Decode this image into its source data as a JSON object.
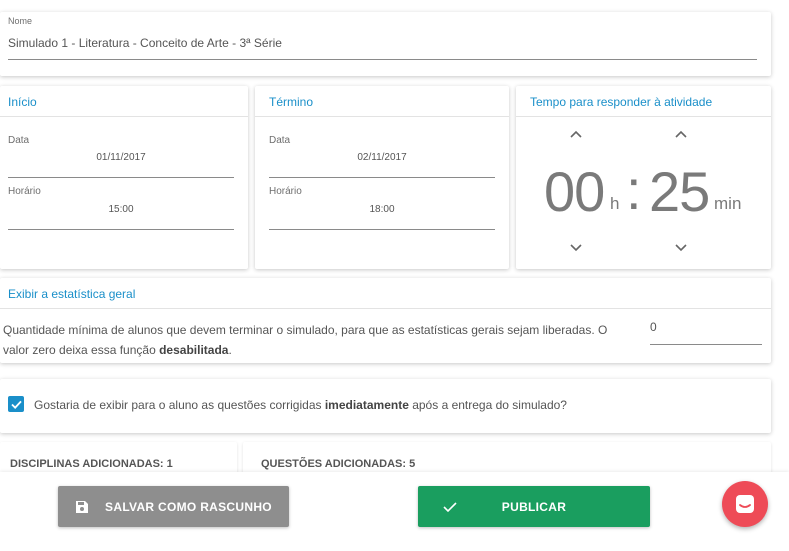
{
  "name_section": {
    "label": "Nome",
    "value": "Simulado 1 - Literatura - Conceito de Arte - 3ª Série"
  },
  "inicio": {
    "title": "Início",
    "date_label": "Data",
    "date_value": "01/11/2017",
    "time_label": "Horário",
    "time_value": "15:00"
  },
  "termino": {
    "title": "Término",
    "date_label": "Data",
    "date_value": "02/11/2017",
    "time_label": "Horário",
    "time_value": "18:00"
  },
  "timer": {
    "title": "Tempo para responder à atividade",
    "hours": "00",
    "hours_unit": "h",
    "separator": ":",
    "minutes": "25",
    "minutes_unit": "min"
  },
  "statistics": {
    "title": "Exibir a estatística geral",
    "description_part1": "Quantidade mínima de alunos que devem terminar o simulado, para que as estatísticas gerais sejam liberadas. O valor zero deixa essa função ",
    "description_bold": "desabilitada",
    "description_end": ".",
    "value": "0"
  },
  "show_corrected": {
    "checked": true,
    "text_part1": "Gostaria de exibir para o aluno as questões corrigidas ",
    "text_bold": "imediatamente",
    "text_part2": " após a entrega do simulado?"
  },
  "counters": {
    "disciplinas": "DISCIPLINAS ADICIONADAS: 1",
    "questoes": "QUESTÕES ADICIONADAS: 5"
  },
  "actions": {
    "save_draft": "SALVAR COMO RASCUNHO",
    "publish": "PUBLICAR"
  },
  "colors": {
    "accent": "#1a8fc9",
    "checkbox": "#1a8fc9",
    "save_button": "#8e8e8e",
    "publish_button": "#1a9e5f",
    "chat_button": "#ee4b57"
  }
}
